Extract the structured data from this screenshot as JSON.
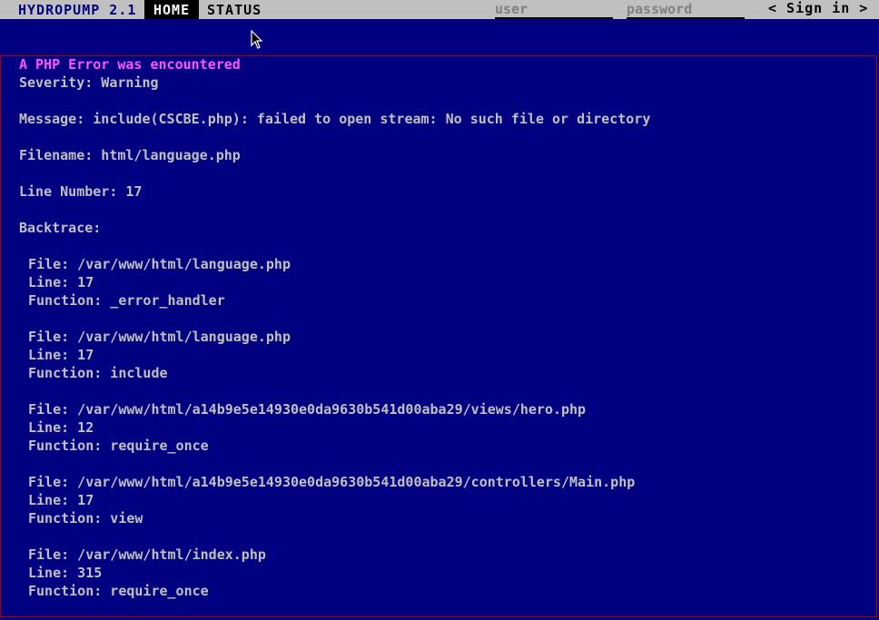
{
  "header": {
    "brand": "HYDROPUMP 2.1",
    "nav": {
      "home": "HOME",
      "status": "STATUS"
    },
    "login": {
      "user_placeholder": "user",
      "password_placeholder": "password",
      "sign_in": "< Sign in >"
    }
  },
  "error": {
    "heading": "A PHP Error was encountered",
    "severity": "Severity: Warning",
    "message": "Message: include(CSCBE.php): failed to open stream: No such file or directory",
    "filename": "Filename: html/language.php",
    "line_number": "Line Number: 17",
    "backtrace_label": "Backtrace:",
    "backtrace": [
      {
        "file": "File: /var/www/html/language.php",
        "line": "Line: 17",
        "function": "Function: _error_handler"
      },
      {
        "file": "File: /var/www/html/language.php",
        "line": "Line: 17",
        "function": "Function: include"
      },
      {
        "file": "File: /var/www/html/a14b9e5e14930e0da9630b541d00aba29/views/hero.php",
        "line": "Line: 12",
        "function": "Function: require_once"
      },
      {
        "file": "File: /var/www/html/a14b9e5e14930e0da9630b541d00aba29/controllers/Main.php",
        "line": "Line: 17",
        "function": "Function: view"
      },
      {
        "file": "File: /var/www/html/index.php",
        "line": "Line: 315",
        "function": "Function: require_once"
      }
    ]
  },
  "colors": {
    "background": "#000080",
    "text": "#c0c0c0",
    "heading": "#ff55ff",
    "border": "#aa0000",
    "bar": "#c0c0c0"
  }
}
